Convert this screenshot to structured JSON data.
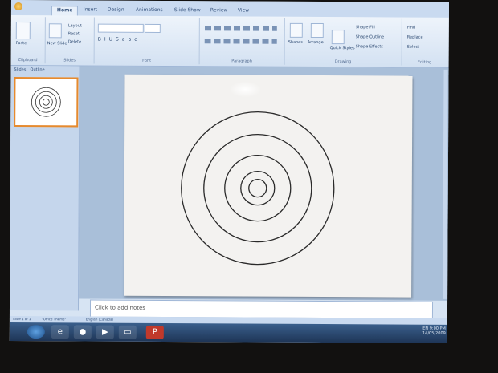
{
  "tabs": [
    "Home",
    "Insert",
    "Design",
    "Animations",
    "Slide Show",
    "Review",
    "View"
  ],
  "ribbon": {
    "groups": [
      "Clipboard",
      "Slides",
      "Font",
      "Paragraph",
      "Drawing",
      "Editing"
    ],
    "paste": "Paste",
    "new_slide": "New Slide",
    "slides_items": [
      "Layout",
      "Reset",
      "Delete"
    ],
    "drawing_items": [
      "Shapes",
      "Arrange",
      "Quick Styles"
    ],
    "shape_items": [
      "Shape Fill",
      "Shape Outline",
      "Shape Effects"
    ],
    "editing_items": [
      "Find",
      "Replace",
      "Select"
    ]
  },
  "panel_tabs": [
    "Slides",
    "Outline"
  ],
  "notes_placeholder": "Click to add notes",
  "status": {
    "slide_info": "Slide 1 of 1",
    "theme": "\"Office Theme\"",
    "language": "English (Canada)"
  },
  "tray": {
    "lang": "EN",
    "time": "9:00 PM",
    "date": "14/05/2009"
  }
}
